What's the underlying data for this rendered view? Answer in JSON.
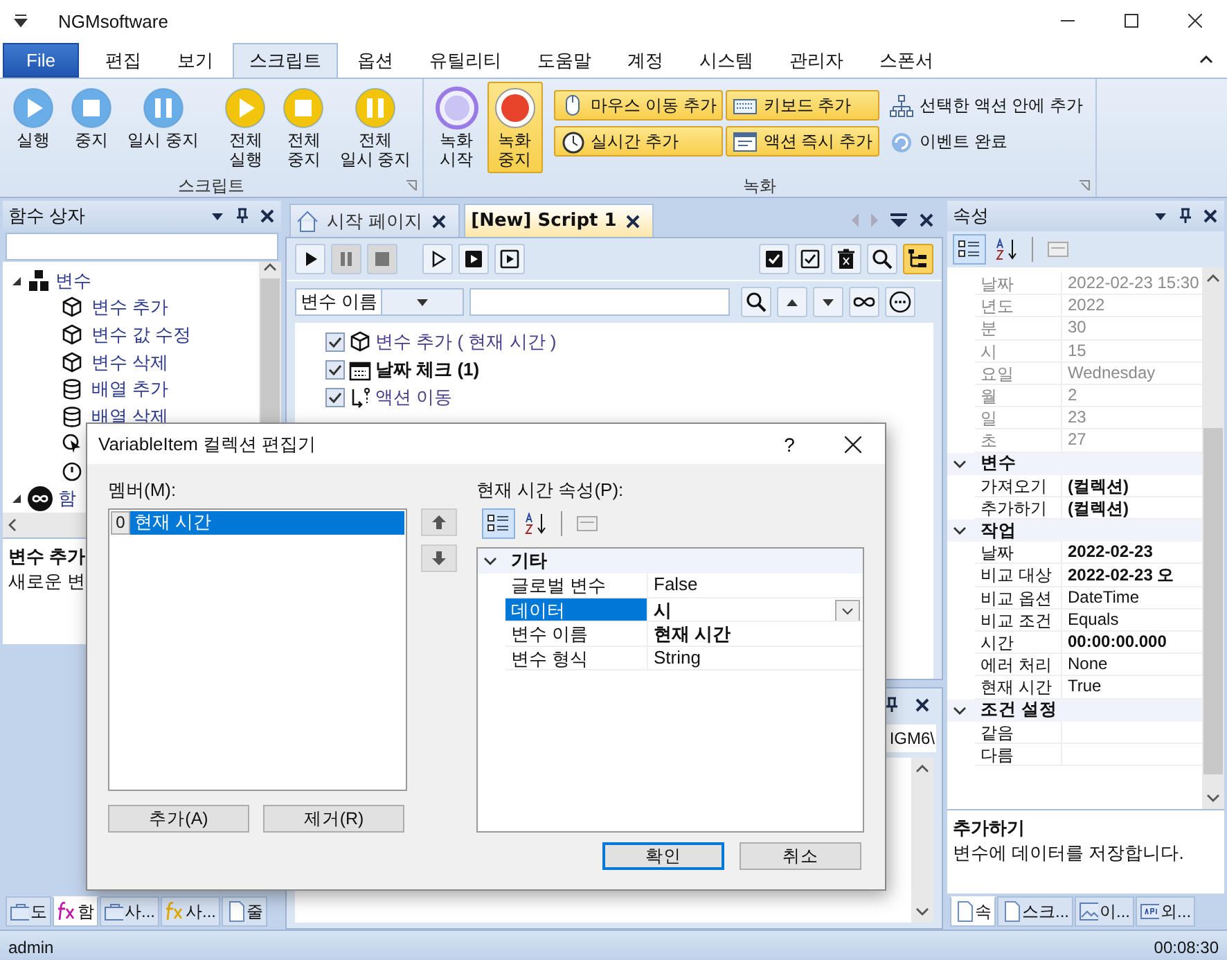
{
  "window": {
    "title": "NGMsoftware"
  },
  "ribbon": {
    "file_tab": "File",
    "tabs": [
      {
        "label": "편집",
        "selected": false
      },
      {
        "label": "보기",
        "selected": false
      },
      {
        "label": "스크립트",
        "selected": true
      },
      {
        "label": "옵션",
        "selected": false
      },
      {
        "label": "유틸리티",
        "selected": false
      },
      {
        "label": "도움말",
        "selected": false
      },
      {
        "label": "계정",
        "selected": false
      },
      {
        "label": "시스템",
        "selected": false
      },
      {
        "label": "관리자",
        "selected": false
      },
      {
        "label": "스폰서",
        "selected": false
      }
    ],
    "groups": [
      {
        "title": "스크립트",
        "large_buttons": [
          {
            "label": "실행",
            "kind": "play",
            "color": "#6aaee8",
            "active": false
          },
          {
            "label": "중지",
            "kind": "stop",
            "color": "#6aaee8",
            "active": false
          },
          {
            "label": "일시 중지",
            "kind": "pause",
            "color": "#6aaee8",
            "active": false
          },
          {
            "label": "전체\n실행",
            "kind": "play",
            "color": "#f2c40c",
            "active": false
          },
          {
            "label": "전체\n중지",
            "kind": "stop",
            "color": "#f2c40c",
            "active": false
          },
          {
            "label": "전체\n일시 중지",
            "kind": "pause",
            "color": "#f2c40c",
            "active": false
          }
        ]
      },
      {
        "title": "녹화",
        "large_buttons": [
          {
            "label": "녹화\n시작",
            "kind": "record",
            "color": "#9a7ae6",
            "active": false
          },
          {
            "label": "녹화\n중지",
            "kind": "record-stop",
            "color": "#e8442c",
            "active": true
          }
        ],
        "small_buttons": [
          {
            "label": "마우스 이동 추가",
            "active": true
          },
          {
            "label": "키보드 추가",
            "active": true
          },
          {
            "label": "선택한 액션 안에 추가",
            "active": false
          },
          {
            "label": "실시간 추가",
            "active": true
          },
          {
            "label": "액션 즉시 추가",
            "active": true
          },
          {
            "label": "이벤트 완료",
            "active": false
          }
        ]
      }
    ]
  },
  "function_box": {
    "title": "함수 상자",
    "groups": [
      {
        "label": "변수",
        "expanded": true,
        "children": [
          {
            "label": "변수 추가"
          },
          {
            "label": "변수 값 수정"
          },
          {
            "label": "변수 삭제"
          },
          {
            "label": "배열 추가"
          },
          {
            "label": "배열 삭제"
          }
        ]
      },
      {
        "label": "함",
        "expanded": true
      }
    ],
    "description_title": "변수 추가",
    "description": "새로운 변",
    "tabs": [
      {
        "label": "도",
        "selected": false
      },
      {
        "label": "함",
        "selected": true
      },
      {
        "label": "사...",
        "selected": false
      },
      {
        "label": "사...",
        "selected": false
      },
      {
        "label": "줄",
        "selected": false
      }
    ]
  },
  "documents": {
    "tabs": [
      {
        "label": "시작 페이지",
        "selected": false
      },
      {
        "label": "[New] Script 1",
        "selected": true
      }
    ],
    "toolbar": [
      {
        "kind": "play",
        "disabled": false,
        "active": false
      },
      {
        "kind": "pause",
        "disabled": true,
        "active": false
      },
      {
        "kind": "stop",
        "disabled": true,
        "active": false
      },
      {
        "kind": "play-outline",
        "disabled": false,
        "active": false
      },
      {
        "kind": "play-box",
        "disabled": false,
        "active": false
      },
      {
        "kind": "play-frame",
        "disabled": false,
        "active": false
      },
      {
        "kind": "check-filled",
        "disabled": false,
        "active": false
      },
      {
        "kind": "check-outline",
        "disabled": false,
        "active": false
      },
      {
        "kind": "delete",
        "disabled": false,
        "active": false
      },
      {
        "kind": "search",
        "disabled": false,
        "active": false
      },
      {
        "kind": "tree",
        "disabled": false,
        "active": true
      }
    ],
    "search_field": "변수 이름",
    "actions": [
      {
        "label": "변수 추가 ( 현재 시간 )",
        "kind": "variable",
        "checked": true
      },
      {
        "label": "날짜 체크 (1)",
        "kind": "condition",
        "checked": true
      },
      {
        "label": "액션 이동",
        "kind": "jump",
        "checked": true
      }
    ],
    "output_path": "IGM6\\"
  },
  "properties": {
    "title": "속성",
    "categorized": true,
    "sections": [
      {
        "rows": [
          {
            "name": "날짜",
            "value": "2022-02-23 15:30",
            "readonly": true,
            "modified": false
          },
          {
            "name": "년도",
            "value": "2022",
            "readonly": true,
            "modified": false
          },
          {
            "name": "분",
            "value": "30",
            "readonly": true,
            "modified": false
          },
          {
            "name": "시",
            "value": "15",
            "readonly": true,
            "modified": false
          },
          {
            "name": "요일",
            "value": "Wednesday",
            "readonly": true,
            "modified": false
          },
          {
            "name": "월",
            "value": "2",
            "readonly": true,
            "modified": false
          },
          {
            "name": "일",
            "value": "23",
            "readonly": true,
            "modified": false
          },
          {
            "name": "초",
            "value": "27",
            "readonly": true,
            "modified": false
          }
        ]
      },
      {
        "title": "변수",
        "expanded": true,
        "rows": [
          {
            "name": "가져오기",
            "value": "(컬렉션)",
            "readonly": false,
            "modified": true
          },
          {
            "name": "추가하기",
            "value": "(컬렉션)",
            "readonly": false,
            "modified": true
          }
        ]
      },
      {
        "title": "작업",
        "expanded": true,
        "rows": [
          {
            "name": "날짜",
            "value": "2022-02-23",
            "readonly": false,
            "modified": true
          },
          {
            "name": "비교 대상",
            "value": "2022-02-23 오",
            "readonly": false,
            "modified": true
          },
          {
            "name": "비교 옵션",
            "value": "DateTime",
            "readonly": false,
            "modified": false
          },
          {
            "name": "비교 조건",
            "value": "Equals",
            "readonly": false,
            "modified": false
          },
          {
            "name": "시간",
            "value": "00:00:00.000",
            "readonly": false,
            "modified": true
          },
          {
            "name": "에러 처리",
            "value": "None",
            "readonly": false,
            "modified": false
          },
          {
            "name": "현재 시간",
            "value": "True",
            "readonly": false,
            "modified": false
          }
        ]
      },
      {
        "title": "조건 설정",
        "expanded": true,
        "rows": [
          {
            "name": "같음",
            "readonly": false
          },
          {
            "name": "다름",
            "readonly": false
          }
        ]
      }
    ],
    "description_title": "추가하기",
    "description": "변수에 데이터를 저장합니다.",
    "tabs": [
      {
        "label": "속",
        "selected": true
      },
      {
        "label": "스크...",
        "selected": false
      },
      {
        "label": "이...",
        "selected": false
      },
      {
        "label": "외...",
        "selected": false
      }
    ]
  },
  "dialog": {
    "title": "VariableItem 컬렉션 편집기",
    "help": "?",
    "members_label": "멤버(M):",
    "members": [
      {
        "index": "0",
        "label": "현재 시간",
        "selected": true
      }
    ],
    "add_button": "추가(A)",
    "remove_button": "제거(R)",
    "properties_label": "현재 시간 속성(P):",
    "grid": {
      "categorized": true,
      "sections": [
        {
          "title": "기타",
          "expanded": true,
          "rows": [
            {
              "name": "글로벌 변수",
              "value": "False",
              "modified": false,
              "selected": false
            },
            {
              "name": "데이터",
              "value": "시",
              "modified": true,
              "selected": true
            },
            {
              "name": "변수 이름",
              "value": "현재 시간",
              "modified": true,
              "selected": false
            },
            {
              "name": "변수 형식",
              "value": "String",
              "modified": false,
              "selected": false
            }
          ]
        }
      ]
    },
    "ok_button": "확인",
    "cancel_button": "취소"
  },
  "status_bar": {
    "user": "admin",
    "time": "00:08:30"
  }
}
